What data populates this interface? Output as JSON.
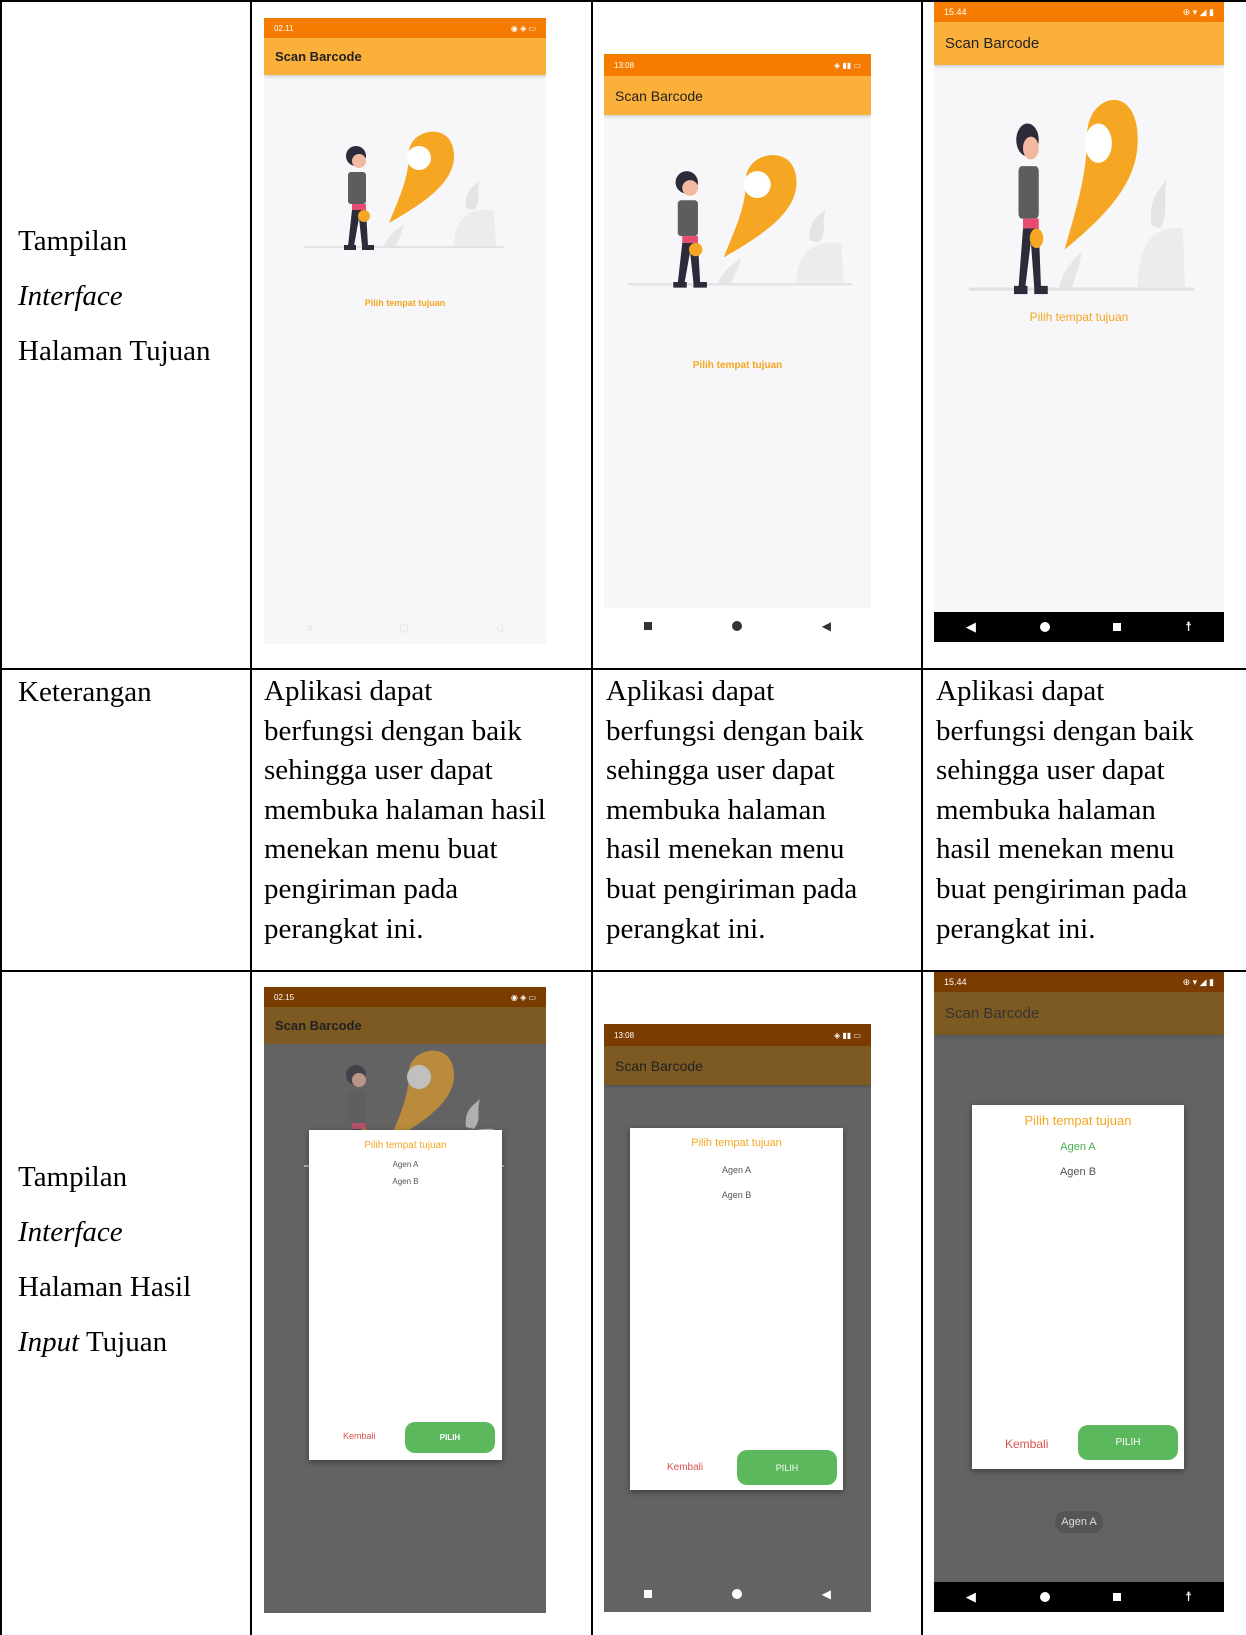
{
  "rows": {
    "row1_label": [
      "Tampilan",
      "Interface",
      "Halaman Tujuan"
    ],
    "ket_label": "Keterangan",
    "row3_label": [
      "Tampilan",
      "Interface",
      "Halaman Hasil",
      "Input",
      "Tujuan"
    ]
  },
  "keterangan": {
    "col1": [
      "Aplikasi dapat",
      "berfungsi dengan baik",
      "sehingga user dapat",
      "membuka halaman hasil",
      "menekan menu buat",
      "pengiriman pada",
      "perangkat ini."
    ],
    "col2": [
      "Aplikasi dapat",
      "berfungsi dengan baik",
      "sehingga user dapat",
      "membuka halaman",
      "hasil menekan menu",
      "buat pengiriman pada",
      "perangkat ini."
    ],
    "col3": [
      "Aplikasi dapat",
      "berfungsi dengan baik",
      "sehingga user dapat",
      "membuka halaman",
      "hasil menekan menu",
      "buat pengiriman pada",
      "perangkat ini."
    ]
  },
  "phones": {
    "p1": {
      "time": "02.11",
      "title": "Scan Barcode",
      "pick": "Pilih tempat tujuan"
    },
    "p2": {
      "time": "13:08",
      "title": "Scan Barcode",
      "pick": "Pilih tempat tujuan"
    },
    "p3": {
      "time": "15.44",
      "title": "Scan Barcode",
      "pick": "Pilih tempat tujuan"
    },
    "p4": {
      "time": "02.15",
      "title": "Scan Barcode"
    },
    "p5": {
      "time": "13:08",
      "title": "Scan Barcode"
    },
    "p6": {
      "time": "15.44",
      "title": "Scan Barcode"
    }
  },
  "dialog": {
    "title": "Pilih tempat tujuan",
    "option_a": "Agen A",
    "option_b": "Agen B",
    "back": "Kembali",
    "confirm": "PILIH",
    "toast": "Agen A"
  },
  "colors": {
    "statusbar": "#f57c00",
    "appbar": "#fbb03b",
    "accent": "#f5a623",
    "confirm": "#5cb85c",
    "back": "#d9534f",
    "selected": "#4caf50"
  }
}
